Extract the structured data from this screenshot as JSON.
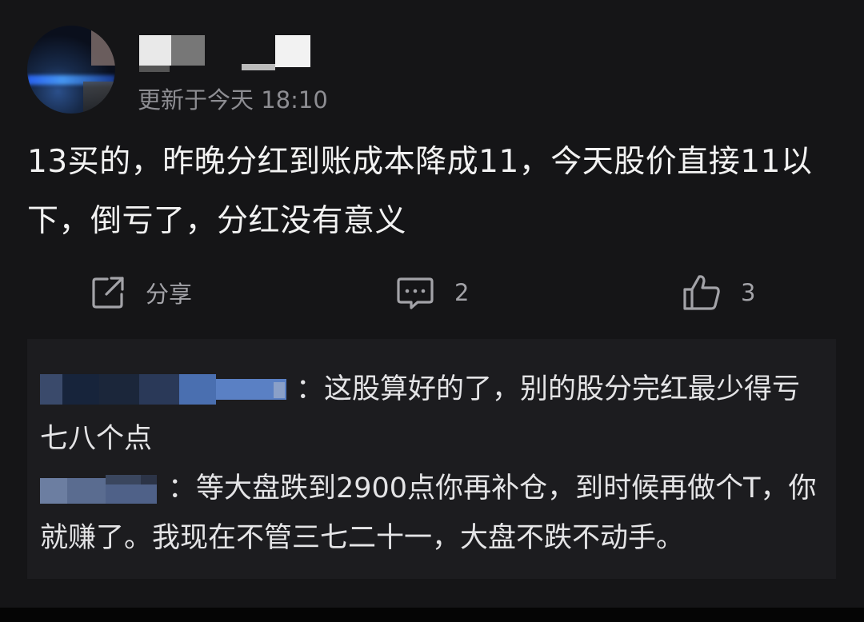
{
  "post": {
    "meta": "更新于今天 18:10",
    "content": "13买的，昨晚分红到账成本降成11，今天股价直接11以下，倒亏了，分红没有意义",
    "actions": {
      "share_icon": "share-icon",
      "share_label": "分享",
      "comment_icon": "comment-icon",
      "comment_count": "2",
      "like_icon": "thumbs-up-icon",
      "like_count": "3"
    }
  },
  "comments": [
    {
      "text": "：这股算好的了，别的股分完红最少得亏七八个点"
    },
    {
      "text": "：等大盘跌到2900点你再补仓，到时候再做个T，你就赚了。我现在不管三七二十一，大盘不跌不动手。"
    }
  ]
}
